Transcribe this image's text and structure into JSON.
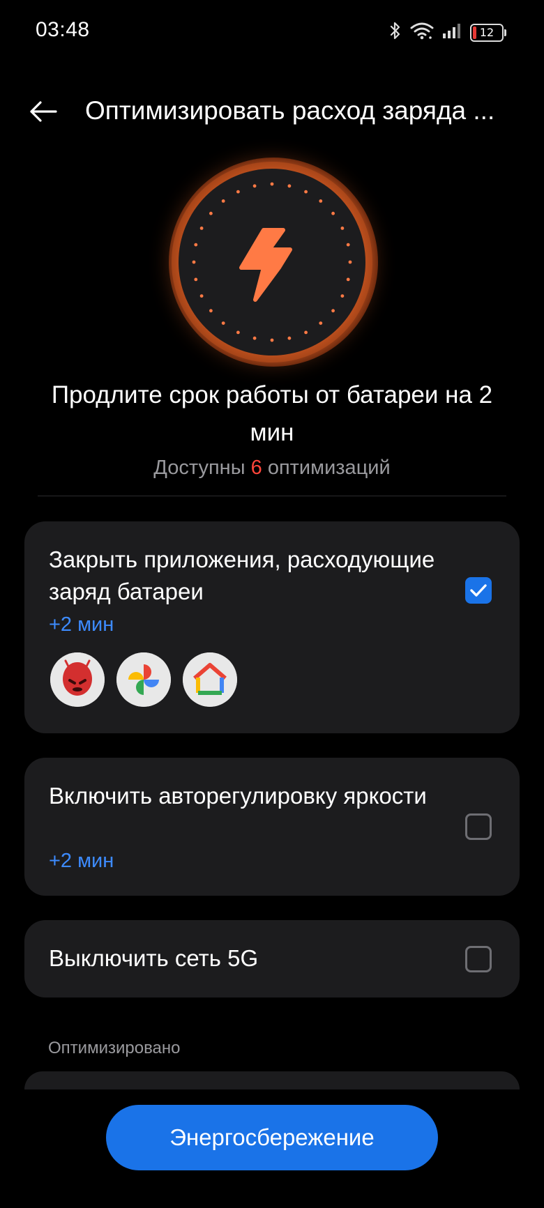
{
  "status_bar": {
    "time": "03:48",
    "battery_level": "12",
    "battery_color": "#e53935"
  },
  "header": {
    "back_icon": "arrow-left-icon",
    "title": "Оптимизировать расход заряда ..."
  },
  "hero": {
    "icon": "lightning-bolt-icon",
    "accent_color": "#ff7a45"
  },
  "summary": {
    "headline": "Продлите срок работы от батареи на 2 мин",
    "available_prefix": "Доступны",
    "available_count": "6",
    "available_suffix": "оптимизаций"
  },
  "options": [
    {
      "title": "Закрыть приложения, расходующие заряд батареи",
      "gain": "+2 мин",
      "checked": true,
      "apps": [
        "antutu-app-icon",
        "google-photos-app-icon",
        "google-home-app-icon"
      ]
    },
    {
      "title": "Включить авторегулировку яркости",
      "gain": "+2 мин",
      "checked": false
    },
    {
      "title": "Выключить сеть 5G",
      "checked": false
    }
  ],
  "optimized_section": {
    "label": "Оптимизировано"
  },
  "footer": {
    "button_label": "Энергосбережение",
    "accent_color": "#1a73e8"
  }
}
